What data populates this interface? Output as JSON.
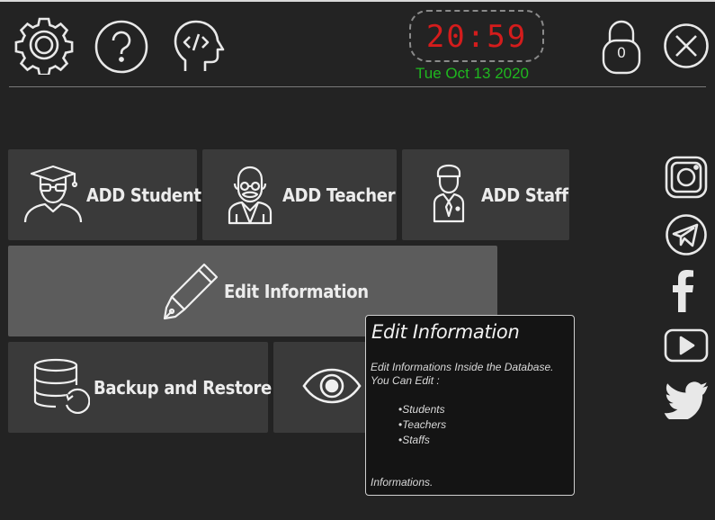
{
  "header": {
    "settings_icon": "gear-icon",
    "help_icon": "question-icon",
    "developer_icon": "developer-head-icon",
    "clock": {
      "time": "20:59",
      "date": "Tue Oct 13 2020",
      "time_color": "#d41c1c",
      "date_color": "#1fb81f"
    },
    "lock": {
      "count": "0"
    },
    "close_icon": "close-icon"
  },
  "tiles": {
    "add_student": {
      "label": "ADD Student",
      "icon": "student-icon"
    },
    "add_teacher": {
      "label": "ADD Teacher",
      "icon": "teacher-icon"
    },
    "add_staff": {
      "label": "ADD Staff",
      "icon": "staff-icon"
    },
    "edit_information": {
      "label": "Edit Information",
      "icon": "pen-icon"
    },
    "backup_restore": {
      "label": "Backup and Restore",
      "icon": "database-icon"
    },
    "view": {
      "label": "",
      "icon": "eye-icon"
    }
  },
  "tooltip": {
    "title": "Edit Information",
    "description": "Edit Informations Inside the Database. You Can Edit :",
    "items": [
      "Students",
      "Teachers",
      "Staffs"
    ],
    "footer": "Informations."
  },
  "social": [
    "instagram-icon",
    "telegram-icon",
    "facebook-icon",
    "youtube-icon",
    "twitter-icon"
  ],
  "colors": {
    "background": "#232323",
    "tile": "#3a3a3a",
    "tile_hover": "#5c5c5c"
  }
}
